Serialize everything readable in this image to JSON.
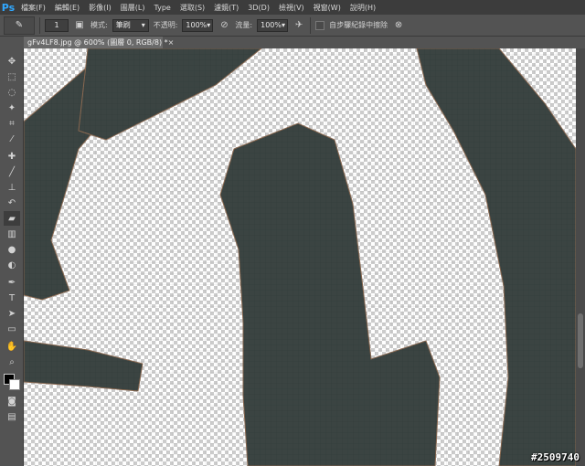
{
  "app": {
    "logo": "Ps"
  },
  "menu": [
    "檔案(F)",
    "編輯(E)",
    "影像(I)",
    "圖層(L)",
    "Type",
    "選取(S)",
    "濾鏡(T)",
    "3D(D)",
    "檢視(V)",
    "視窗(W)",
    "說明(H)"
  ],
  "options": {
    "brush_size": "1",
    "mode_label": "模式:",
    "mode_value": "筆刷",
    "opacity_label": "不透明:",
    "opacity_value": "100%",
    "flow_label": "流量:",
    "flow_value": "100%",
    "auto_erase_label": "自步驟紀錄中擦除"
  },
  "document": {
    "tab_title": "gFv4LF8.jpg @ 600% (圖層 0, RGB/8) *",
    "close": "×"
  },
  "tools": [
    "move-icon",
    "marquee-icon",
    "lasso-icon",
    "magic-wand-icon",
    "crop-icon",
    "eyedropper-icon",
    "healing-icon",
    "brush-icon",
    "stamp-icon",
    "history-brush-icon",
    "eraser-icon",
    "gradient-icon",
    "blur-icon",
    "dodge-icon",
    "pen-icon",
    "type-icon",
    "path-select-icon",
    "shape-icon",
    "hand-icon",
    "zoom-icon"
  ],
  "colors": {
    "foreground": "#000000",
    "background": "#ffffff",
    "ink": "#3b4442"
  },
  "watermark": "#2509740"
}
